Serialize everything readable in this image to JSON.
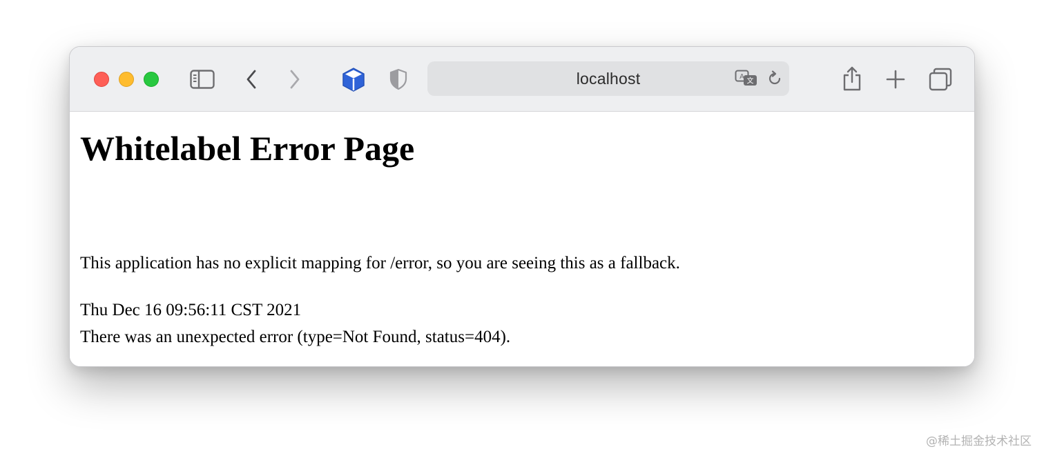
{
  "browser": {
    "url": "localhost",
    "icons": {
      "sidebar": "sidebar-icon",
      "back": "chevron-left-icon",
      "forward": "chevron-right-icon",
      "extension": "cube-extension-icon",
      "privacy": "shield-icon",
      "translate": "translate-icon",
      "reload": "reload-icon",
      "share": "share-icon",
      "new_tab": "plus-icon",
      "tab_overview": "tab-overview-icon"
    },
    "colors": {
      "close": "#fe5f57",
      "minimize": "#febc2e",
      "maximize": "#28c840",
      "extension_blue": "#2f63d8",
      "toolbar_bg": "#eeeff1"
    }
  },
  "page": {
    "title": "Whitelabel Error Page",
    "message": "This application has no explicit mapping for /error, so you are seeing this as a fallback.",
    "timestamp": "Thu Dec 16 09:56:11 CST 2021",
    "error": "There was an unexpected error (type=Not Found, status=404)."
  },
  "watermark": "@稀土掘金技术社区"
}
